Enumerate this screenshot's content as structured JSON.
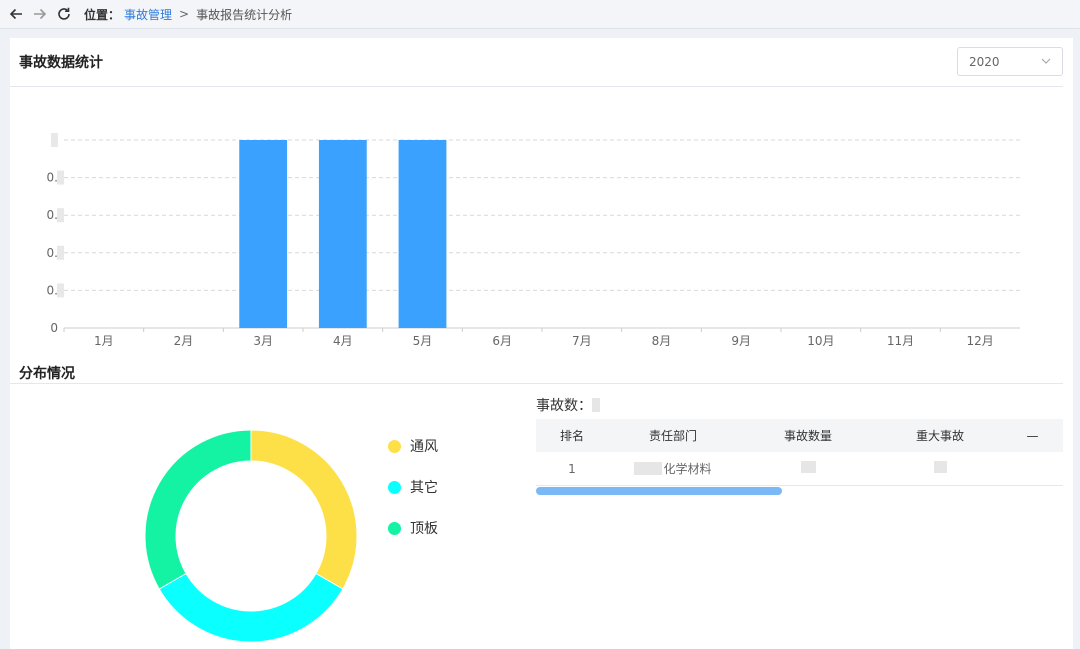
{
  "nav": {
    "location_label": "位置：",
    "breadcrumb_link": "事故管理",
    "separator": ">",
    "current_page": "事故报告统计分析"
  },
  "stats_section": {
    "title": "事故数据统计",
    "year_select_value": "2020"
  },
  "distribution_section": {
    "title": "分布情况",
    "count_label": "事故数："
  },
  "chart_data": [
    {
      "type": "bar",
      "categories": [
        "1月",
        "2月",
        "3月",
        "4月",
        "5月",
        "6月",
        "7月",
        "8月",
        "9月",
        "10月",
        "11月",
        "12月"
      ],
      "values": [
        0,
        0,
        1,
        1,
        1,
        0,
        0,
        0,
        0,
        0,
        0,
        0
      ],
      "ylim": [
        0,
        1
      ],
      "y_tick_labels": [
        "0",
        "0.",
        "0.",
        "0.",
        "0.",
        ""
      ],
      "grid": true,
      "bar_color": "#3aa1ff"
    },
    {
      "type": "pie",
      "style": "donut",
      "labels": [
        "通风",
        "其它",
        "顶板"
      ],
      "values": [
        1,
        1,
        1
      ],
      "colors": [
        "#fde047",
        "#0affff",
        "#14f3a4"
      ],
      "legend_position": "right"
    }
  ],
  "table": {
    "headers": [
      "排名",
      "责任部门",
      "事故数量",
      "重大事故",
      "—"
    ],
    "rows": [
      {
        "rank": "1",
        "department": "化学材料",
        "count": "",
        "major": ""
      }
    ]
  },
  "colors": {
    "accent": "#3aa1ff",
    "link": "#2f7bd9",
    "scrollbar": "#7ab9f5"
  }
}
